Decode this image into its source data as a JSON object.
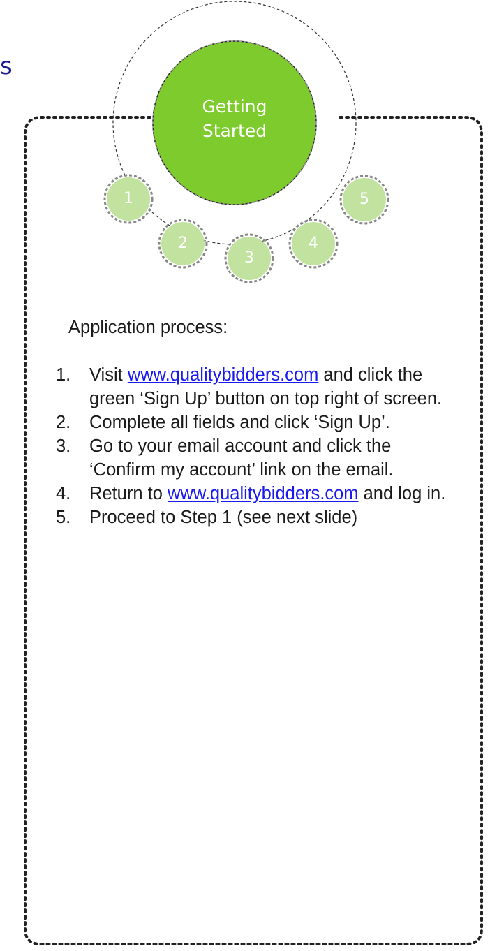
{
  "page_title_fragment": "s",
  "hub": {
    "label_line1": "Getting",
    "label_line2": "Started",
    "color": "#7dcb2c"
  },
  "steps": [
    "1",
    "2",
    "3",
    "4",
    "5"
  ],
  "step_color": "#c2e3a0",
  "content": {
    "heading": "Application process:",
    "items": [
      {
        "num": "1.",
        "pre": "Visit ",
        "link": "www.qualitybidders.com",
        "post": " and click the green ‘Sign Up’ button on top right of screen."
      },
      {
        "num": "2.",
        "text": "Complete all fields and click ‘Sign Up’."
      },
      {
        "num": "3.",
        "text": "Go to your email account and click the ‘Confirm my account’ link on the email."
      },
      {
        "num": "4.",
        "pre": "Return to ",
        "link": "www.qualitybidders.com",
        "post": " and log in."
      },
      {
        "num": "5.",
        "text": "Proceed to Step 1 (see next slide)"
      }
    ]
  },
  "title_color": "#1a1a8c",
  "link_color": "#1a1af0"
}
